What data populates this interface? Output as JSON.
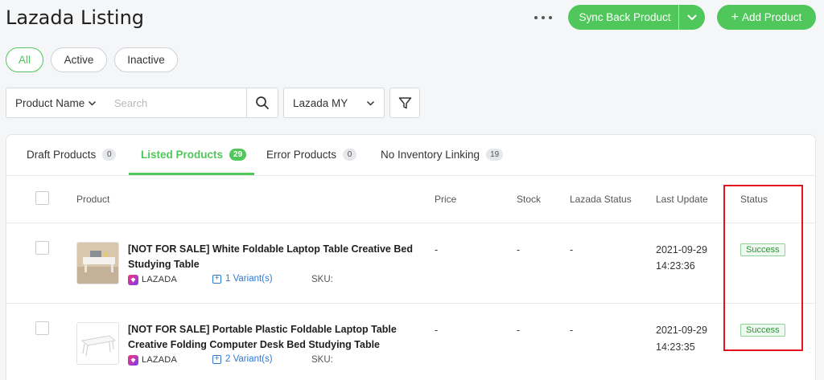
{
  "page": {
    "title": "Lazada Listing"
  },
  "header": {
    "more_icon": "more-dots-icon",
    "sync_button": "Sync Back Product",
    "add_button": "Add Product",
    "accent_color": "#4fc75a"
  },
  "filters": {
    "pills": [
      "All",
      "Active",
      "Inactive"
    ],
    "selected_pill": "All"
  },
  "search": {
    "field": "Product Name",
    "placeholder": "Search",
    "store": "Lazada MY"
  },
  "tabs": [
    {
      "label": "Draft Products",
      "count": "0"
    },
    {
      "label": "Listed Products",
      "count": "29"
    },
    {
      "label": "Error Products",
      "count": "0"
    },
    {
      "label": "No Inventory Linking",
      "count": "19"
    }
  ],
  "active_tab": "Listed Products",
  "table": {
    "columns": [
      "Product",
      "Price",
      "Stock",
      "Lazada Status",
      "Last Update",
      "Status"
    ],
    "rows": [
      {
        "name": "[NOT FOR SALE] White Foldable Laptop Table Creative Bed Studying Table",
        "platform": "LAZADA",
        "variants": "1 Variant(s)",
        "sku": "SKU:",
        "price": "-",
        "stock": "-",
        "lazada_status": "-",
        "date": "2021-09-29",
        "time": "14:23:36",
        "status": "Success"
      },
      {
        "name": "[NOT FOR SALE] Portable Plastic Foldable Laptop Table Creative Folding Computer Desk Bed Studying Table",
        "platform": "LAZADA",
        "variants": "2 Variant(s)",
        "sku": "SKU:",
        "price": "-",
        "stock": "-",
        "lazada_status": "-",
        "date": "2021-09-29",
        "time": "14:23:35",
        "status": "Success"
      }
    ]
  },
  "status_color": "#2f8f3a",
  "annotation_color": "#e3121c"
}
